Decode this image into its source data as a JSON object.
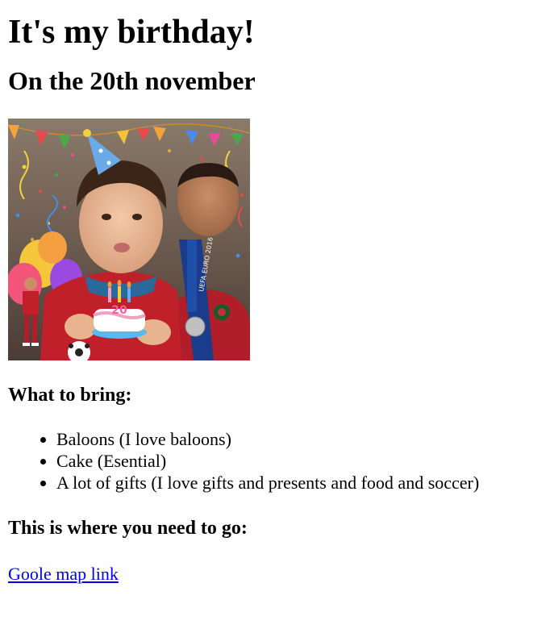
{
  "title": "It's my birthday!",
  "date_heading": "On the 20th november",
  "photo": {
    "cake_number": "20",
    "medal_text": "UEFA EURO 2016"
  },
  "bring_heading": "What to bring:",
  "bring_items": [
    "Baloons (I love baloons)",
    "Cake (Esential)",
    "A lot of gifts (I love gifts and presents and food and soccer)"
  ],
  "location_heading": "This is where you need to go:",
  "map_link_label": "Goole map link"
}
